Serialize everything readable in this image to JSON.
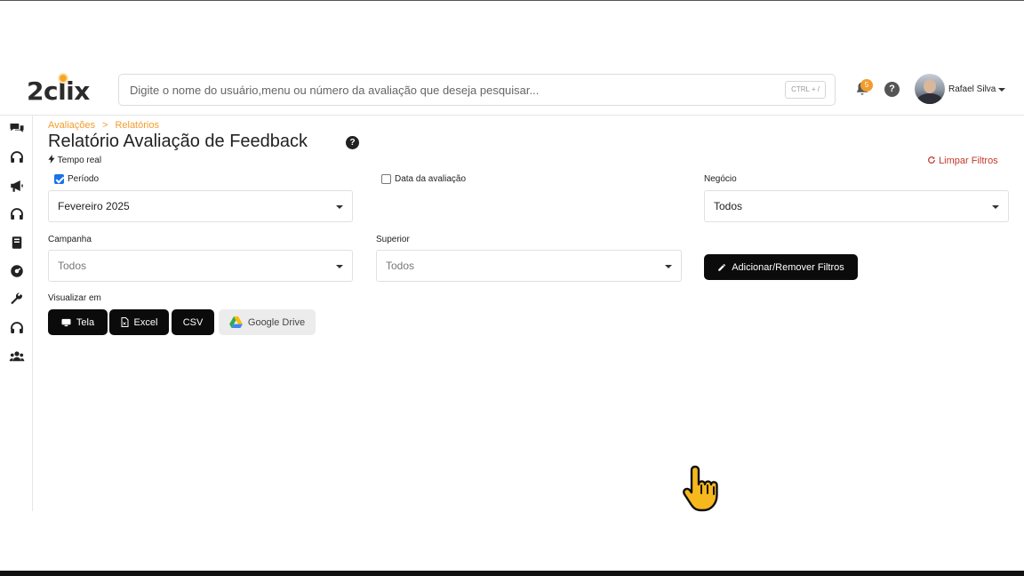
{
  "header": {
    "logo": "2clix",
    "search_placeholder": "Digite o nome do usuário,menu ou número da avaliação que deseja pesquisar...",
    "search_shortcut": "CTRL + /",
    "notifications_count": "5",
    "help_symbol": "?",
    "user_name": "Rafael Silva"
  },
  "sidebar": {
    "icons": [
      "chat-icon",
      "headset-icon",
      "megaphone-icon",
      "headset-icon",
      "book-icon",
      "dashboard-icon",
      "wrench-icon",
      "headset-icon",
      "team-icon"
    ]
  },
  "breadcrumb": {
    "items": [
      "Avaliações",
      "Relatórios"
    ],
    "separator": ">"
  },
  "page": {
    "title": "Relatório Avaliação de Feedback",
    "title_help": "?",
    "realtime_label": "Tempo real",
    "clear_filters": "Limpar Filtros"
  },
  "filters": {
    "periodo": {
      "label": "Período",
      "checked": true,
      "value": "Fevereiro 2025"
    },
    "data_avaliacao": {
      "label": "Data da avaliação",
      "checked": false
    },
    "negocio": {
      "label": "Negócio",
      "value": "Todos"
    },
    "campanha": {
      "label": "Campanha",
      "value": "Todos"
    },
    "superior": {
      "label": "Superior",
      "value": "Todos"
    },
    "add_remove_button": "Adicionar/Remover Filtros"
  },
  "view": {
    "label": "Visualizar em",
    "buttons": {
      "tela": "Tela",
      "excel": "Excel",
      "csv": "CSV",
      "google_drive": "Google Drive"
    }
  },
  "colors": {
    "accent": "#f39c2b",
    "danger": "#c0392b",
    "dark_button": "#0b0b0b",
    "checkbox": "#1a73e8"
  }
}
